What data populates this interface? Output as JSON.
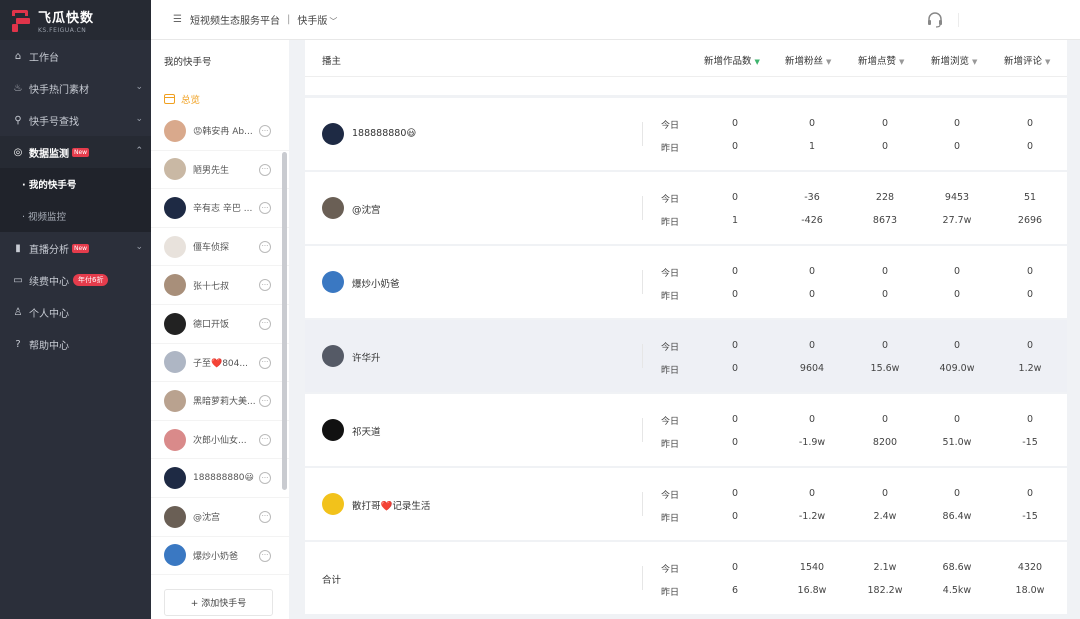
{
  "app": {
    "name": "飞瓜快数",
    "domain": "KS.FEIGUA.CN"
  },
  "nav": {
    "items": [
      {
        "label": "工作台",
        "icon": "home-icon"
      },
      {
        "label": "快手热门素材",
        "icon": "flame-icon",
        "chevron": "chevron-down-icon"
      },
      {
        "label": "快手号查找",
        "icon": "search-icon",
        "chevron": "chevron-down-icon"
      },
      {
        "label": "数据监测",
        "icon": "monitor-icon",
        "chevron": "chevron-up-icon",
        "badge": "New",
        "active": true,
        "children": [
          {
            "label": "· 我的快手号",
            "active": true
          },
          {
            "label": "· 视频监控"
          }
        ]
      },
      {
        "label": "直播分析",
        "icon": "bar-chart-icon",
        "chevron": "chevron-down-icon",
        "badge": "New"
      },
      {
        "label": "续费中心",
        "icon": "card-icon",
        "badge": "年付6折"
      },
      {
        "label": "个人中心",
        "icon": "user-icon"
      },
      {
        "label": "帮助中心",
        "icon": "help-icon"
      }
    ]
  },
  "topbar": {
    "platform": "短视频生态服务平台",
    "separator": "|",
    "version": "快手版"
  },
  "accounts": {
    "title": "我的快手号",
    "overview": "总览",
    "add_button": "+ 添加快手号",
    "items": [
      {
        "name": "😡韩安冉 Ab...",
        "color": "#d9a98c"
      },
      {
        "name": "陋男先生",
        "color": "#c9b8a4"
      },
      {
        "name": "辛有志 辛巴 ...",
        "color": "#1e2a44"
      },
      {
        "name": "僵车侦探",
        "color": "#e8e2dc"
      },
      {
        "name": "张十七叔",
        "color": "#a88f7a"
      },
      {
        "name": "德口开饭",
        "color": "#222222"
      },
      {
        "name": "子至❤️804...",
        "color": "#aeb6c4"
      },
      {
        "name": "黑暗萝莉大美...",
        "color": "#b9a28f"
      },
      {
        "name": "次郎小仙女...",
        "color": "#d98a8a"
      },
      {
        "name": "188888880😃",
        "color": "#1e2a44"
      },
      {
        "name": "@沈宫",
        "color": "#6a5f55"
      },
      {
        "name": "爆炒小奶爸",
        "color": "#3a78c2"
      }
    ]
  },
  "table": {
    "headers": [
      "播主",
      "新增作品数",
      "新增粉丝",
      "新增点赞",
      "新增浏览",
      "新增评论"
    ],
    "today_label": "今日",
    "yesterday_label": "昨日",
    "rows": [
      {
        "name": "188888880😃",
        "color": "#1e2a44",
        "today": [
          "0",
          "0",
          "0",
          "0",
          "0"
        ],
        "yesterday": [
          "0",
          "1",
          "0",
          "0",
          "0"
        ]
      },
      {
        "name": "@沈宫",
        "color": "#6a5f55",
        "today": [
          "0",
          "-36",
          "228",
          "9453",
          "51"
        ],
        "yesterday": [
          "1",
          "-426",
          "8673",
          "27.7w",
          "2696"
        ]
      },
      {
        "name": "爆炒小奶爸",
        "color": "#3a78c2",
        "today": [
          "0",
          "0",
          "0",
          "0",
          "0"
        ],
        "yesterday": [
          "0",
          "0",
          "0",
          "0",
          "0"
        ]
      },
      {
        "name": "许华升",
        "color": "#555a66",
        "today": [
          "0",
          "0",
          "0",
          "0",
          "0"
        ],
        "yesterday": [
          "0",
          "9604",
          "15.6w",
          "409.0w",
          "1.2w"
        ],
        "highlight": true
      },
      {
        "name": "祁天道",
        "color": "#111111",
        "today": [
          "0",
          "0",
          "0",
          "0",
          "0"
        ],
        "yesterday": [
          "0",
          "-1.9w",
          "8200",
          "51.0w",
          "-15"
        ]
      },
      {
        "name": "散打哥❤️记录生活",
        "color": "#f2c21b",
        "today": [
          "0",
          "0",
          "0",
          "0",
          "0"
        ],
        "yesterday": [
          "0",
          "-1.2w",
          "2.4w",
          "86.4w",
          "-15"
        ]
      },
      {
        "name": "合计",
        "color": null,
        "today": [
          "0",
          "1540",
          "2.1w",
          "68.6w",
          "4320"
        ],
        "yesterday": [
          "6",
          "16.8w",
          "182.2w",
          "4.5kw",
          "18.0w"
        ]
      }
    ]
  },
  "colors": {
    "nav_bg": "#2b2f3a",
    "accent_red": "#e53c4c",
    "overview_orange": "#f0a020",
    "sort_active": "#3fb46e"
  }
}
